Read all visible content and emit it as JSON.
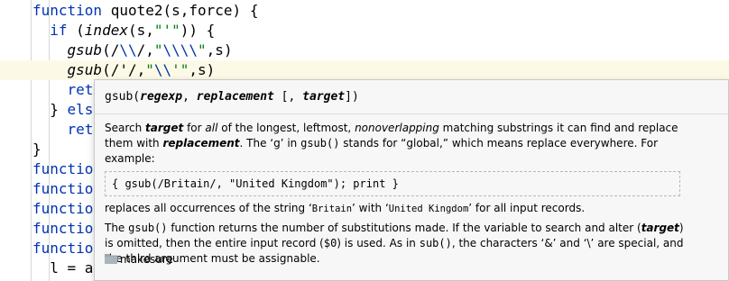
{
  "editor": {
    "lines": [
      {
        "parts": [
          [
            "kw",
            "function"
          ],
          [
            "plain",
            " quote2(s,force) {"
          ]
        ]
      },
      {
        "parts": [
          [
            "plain",
            "  "
          ],
          [
            "kw",
            "if"
          ],
          [
            "plain",
            " ("
          ],
          [
            "it",
            "index"
          ],
          [
            "plain",
            "(s,"
          ],
          [
            "str",
            "\"'\""
          ],
          [
            "plain",
            ")) {"
          ]
        ]
      },
      {
        "parts": [
          [
            "plain",
            "    "
          ],
          [
            "it",
            "gsub"
          ],
          [
            "plain",
            "(/"
          ],
          [
            "esc",
            "\\\\"
          ],
          [
            "plain",
            "/,"
          ],
          [
            "str",
            "\""
          ],
          [
            "esc",
            "\\\\\\\\"
          ],
          [
            "str",
            "\""
          ],
          [
            "plain",
            ",s)"
          ]
        ]
      },
      {
        "parts": [
          [
            "plain",
            "    "
          ],
          [
            "it",
            "gsub"
          ],
          [
            "plain",
            "(/'/,"
          ],
          [
            "str",
            "\""
          ],
          [
            "esc",
            "\\\\"
          ],
          [
            "str",
            "'\""
          ],
          [
            "plain",
            ",s)"
          ]
        ]
      },
      {
        "parts": [
          [
            "plain",
            "    "
          ],
          [
            "kw",
            "ret"
          ]
        ]
      },
      {
        "parts": [
          [
            "plain",
            "  } "
          ],
          [
            "kw",
            "els"
          ]
        ]
      },
      {
        "parts": [
          [
            "plain",
            "    "
          ],
          [
            "kw",
            "ret"
          ]
        ]
      },
      {
        "parts": [
          [
            "plain",
            "}"
          ]
        ]
      },
      {
        "parts": [
          [
            "kw",
            "functio"
          ]
        ]
      },
      {
        "parts": [
          [
            "kw",
            "functio"
          ]
        ]
      },
      {
        "parts": [
          [
            "kw",
            "functio"
          ]
        ]
      },
      {
        "parts": [
          [
            "kw",
            "functio"
          ]
        ]
      },
      {
        "parts": [
          [
            "kw",
            "functio"
          ]
        ]
      },
      {
        "parts": [
          [
            "plain",
            "  l = a"
          ]
        ]
      }
    ]
  },
  "popup": {
    "signature": {
      "name": "gsub(",
      "param1": "regexp",
      "sep": ", ",
      "param2": "replacement",
      "optional": " [, ",
      "param3": "target",
      "close": "])"
    },
    "para1": {
      "t1": "Search ",
      "target": "target",
      "t2": " for ",
      "all": "all",
      "t3": " of the longest, leftmost, ",
      "nonoverlapping": "nonoverlapping",
      "t4": " matching substrings it can find and replace them with ",
      "replacement": "replacement",
      "t5": ". The ‘g’ in ",
      "gsub_code": "gsub()",
      "t6": " stands for “global,” which means replace everywhere. For example:"
    },
    "example_code": "{ gsub(/Britain/, \"United Kingdom\"); print }",
    "para2": {
      "t1": "replaces all occurrences of the string ‘",
      "britain": "Britain",
      "t2": "’ with ‘",
      "uk": "United Kingdom",
      "t3": "’ for all input records."
    },
    "para3": {
      "t1": "The ",
      "gsub_code": "gsub()",
      "t2": " function returns the number of substitutions made. If the variable to search and alter (",
      "target": "target",
      "t3": ") is omitted, then the entire input record (",
      "dollar0": "$0",
      "t4": ") is used. As in ",
      "sub_code": "sub()",
      "t5": ", the characters ‘&’ and ‘\\’ are special, and the third argument must be assignable."
    },
    "footer": {
      "icon": "folder-icon",
      "label": "makesure"
    }
  },
  "colors": {
    "keyword": "#0033b3",
    "string": "#067d17",
    "escape": "#0037a6",
    "current_line": "#fcfae6",
    "popup_bg": "#f7f7f7"
  }
}
